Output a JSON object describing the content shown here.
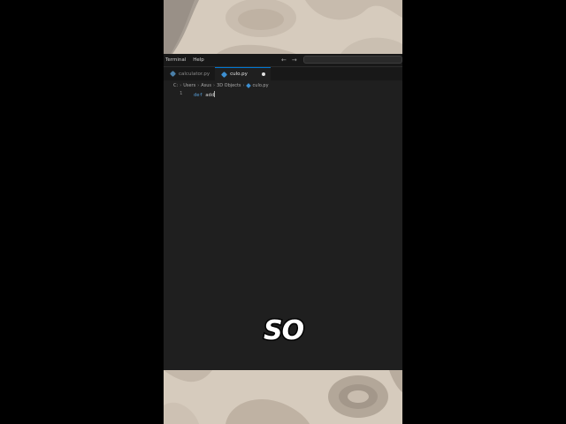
{
  "menubar": {
    "items": [
      "Terminal",
      "Help"
    ],
    "back_arrow": "←",
    "forward_arrow": "→"
  },
  "tabs": [
    {
      "label": "calculator.py",
      "icon": "python-file-icon",
      "active": false
    },
    {
      "label": "culo.py",
      "icon": "python-file-icon",
      "active": true,
      "unsaved": true
    }
  ],
  "breadcrumb": [
    "C:",
    "Users",
    "Asus",
    "3D Objects",
    "culo.py"
  ],
  "editor": {
    "lines": [
      {
        "number": "1",
        "keyword": "def",
        "text": " add"
      }
    ]
  },
  "caption": "SO",
  "colors": {
    "editor_bg": "#1f1f1f",
    "keyword": "#569cd6",
    "wallpaper": "#d6cbbd",
    "python_icon": "#3d8fd1"
  }
}
